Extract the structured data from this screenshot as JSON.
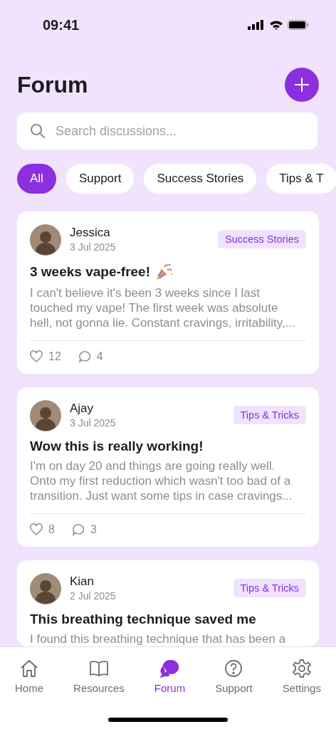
{
  "status_bar": {
    "time": "09:41"
  },
  "header": {
    "title": "Forum"
  },
  "search": {
    "placeholder": "Search discussions..."
  },
  "filters": [
    {
      "label": "All",
      "selected": true
    },
    {
      "label": "Support",
      "selected": false
    },
    {
      "label": "Success Stories",
      "selected": false
    },
    {
      "label": "Tips & T",
      "selected": false
    }
  ],
  "posts": [
    {
      "author": "Jessica",
      "date": "3 Jul 2025",
      "tag": "Success Stories",
      "title": "3 weeks vape-free!",
      "celebration": true,
      "body": "I can't believe it's been 3 weeks since I last touched my vape! The first week was absolute hell, not gonna lie. Constant cravings, irritability,...",
      "likes": "12",
      "comments": "4"
    },
    {
      "author": "Ajay",
      "date": "3 Jul 2025",
      "tag": "Tips & Tricks",
      "title": "Wow this is really working!",
      "celebration": false,
      "body": "I'm on day 20 and things are going really well. Onto my first reduction which wasn't too bad of a transition. Just want some tips in case cravings...",
      "likes": "8",
      "comments": "3"
    },
    {
      "author": "Kian",
      "date": "2 Jul 2025",
      "tag": "Tips & Tricks",
      "title": "This breathing technique saved me",
      "celebration": false,
      "body": "I found this breathing technique that has been a"
    }
  ],
  "tab_bar": [
    {
      "label": "Home",
      "kind": "home",
      "selected": false
    },
    {
      "label": "Resources",
      "kind": "book",
      "selected": false
    },
    {
      "label": "Forum",
      "kind": "chat",
      "selected": true
    },
    {
      "label": "Support",
      "kind": "help",
      "selected": false
    },
    {
      "label": "Settings",
      "kind": "gear",
      "selected": false
    }
  ]
}
